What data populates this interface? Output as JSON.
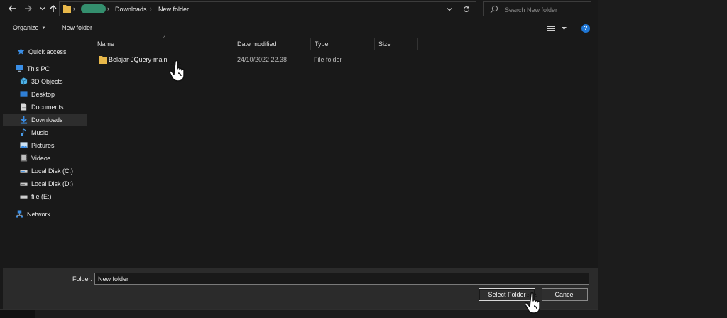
{
  "address": {
    "crumbs": [
      "Downloads",
      "New folder"
    ],
    "search_placeholder": "Search New folder"
  },
  "toolbar": {
    "organize_label": "Organize",
    "new_folder_label": "New folder"
  },
  "nav": {
    "items": [
      {
        "label": "Quick access",
        "icon": "star-icon"
      },
      {
        "label": "This PC",
        "icon": "computer-icon"
      },
      {
        "label": "3D Objects",
        "icon": "cube-icon"
      },
      {
        "label": "Desktop",
        "icon": "desktop-icon"
      },
      {
        "label": "Documents",
        "icon": "document-icon"
      },
      {
        "label": "Downloads",
        "icon": "download-arrow-icon",
        "selected": true
      },
      {
        "label": "Music",
        "icon": "music-note-icon"
      },
      {
        "label": "Pictures",
        "icon": "picture-icon"
      },
      {
        "label": "Videos",
        "icon": "video-icon"
      },
      {
        "label": "Local Disk (C:)",
        "icon": "drive-icon"
      },
      {
        "label": "Local Disk (D:)",
        "icon": "drive-icon"
      },
      {
        "label": "file (E:)",
        "icon": "drive-icon"
      },
      {
        "label": "Network",
        "icon": "network-icon"
      }
    ]
  },
  "columns": {
    "name": "Name",
    "date_modified": "Date modified",
    "type": "Type",
    "size": "Size"
  },
  "files": [
    {
      "name": "Belajar-JQuery-main",
      "date_modified": "24/10/2022 22.38",
      "type": "File folder",
      "size": ""
    }
  ],
  "footer": {
    "folder_label": "Folder:",
    "folder_value": "New folder",
    "select_button": "Select Folder",
    "cancel_button": "Cancel"
  },
  "colors": {
    "background": "#191919",
    "selection": "#2d2d2d",
    "accent": "#1f77d6",
    "folder_yellow": "#e8b84a",
    "redaction": "#3aa57e"
  }
}
